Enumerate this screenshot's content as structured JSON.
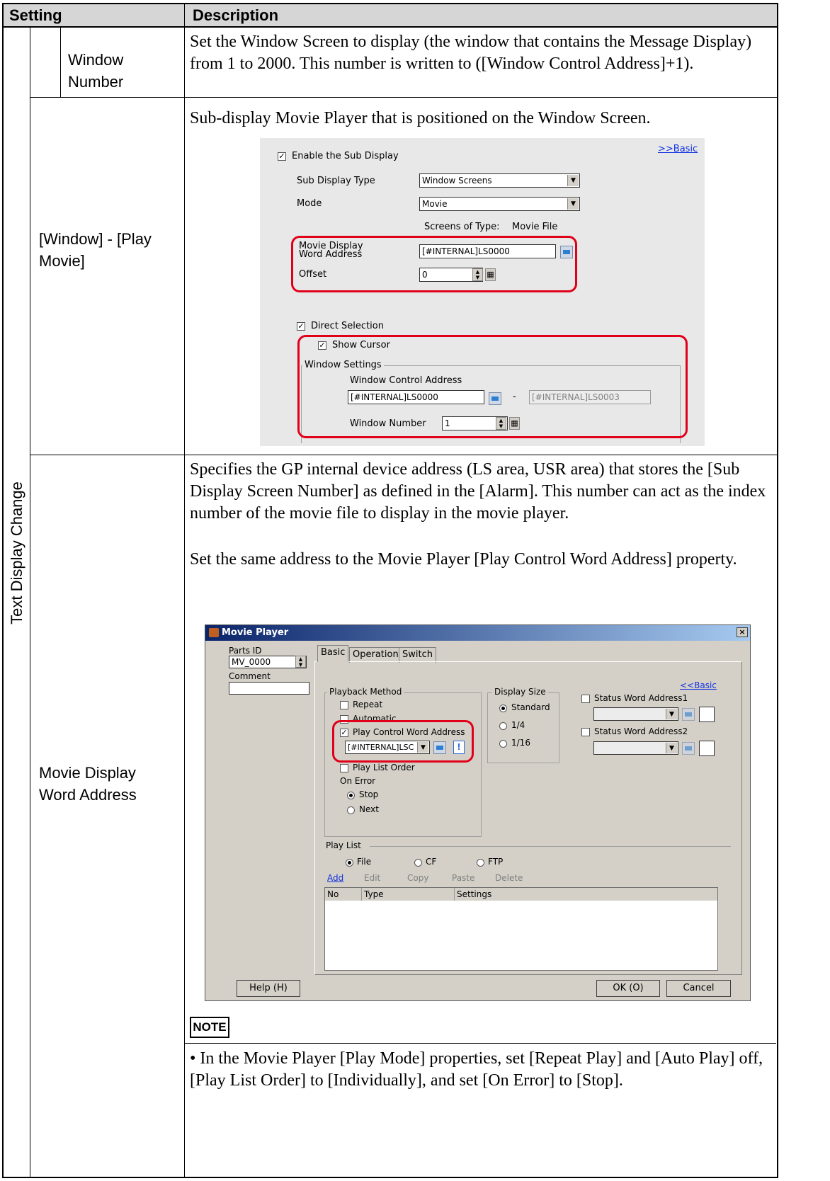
{
  "header": {
    "setting": "Setting",
    "description": "Description"
  },
  "category_vertical": "Text Display Change",
  "rows": [
    {
      "label": "Window Number",
      "desc": "Set the Window Screen to display (the window that contains the Message Display) from 1 to 2000. This number is written to ([Window Control Address]+1)."
    },
    {
      "label": "[Window] - [Play Movie]",
      "desc": "Sub-display Movie Player that is positioned on the Window Screen."
    },
    {
      "label": "Movie Display Word Address",
      "desc": "Specifies the GP internal device address (LS area, USR area) that stores the [Sub Display Screen Number] as defined in the [Alarm]. This number can act as the index number of the movie file to display in the movie player.",
      "desc2": "Set the same address to the Movie Player [Play Control Word Address] property."
    }
  ],
  "subdisplay": {
    "basic_link": ">>Basic",
    "enable_sub_display": "Enable the Sub Display",
    "sub_display_type_label": "Sub Display Type",
    "sub_display_type_value": "Window Screens",
    "mode_label": "Mode",
    "mode_value": "Movie",
    "screens_of_type_label": "Screens of Type:",
    "screens_of_type_value": "Movie File",
    "movie_display_word_label": "Movie Display Word Address",
    "movie_display_word_value": "[#INTERNAL]LS0000",
    "offset_label": "Offset",
    "offset_value": "0",
    "direct_selection": "Direct Selection",
    "show_cursor": "Show Cursor",
    "window_settings": "Window Settings",
    "window_control_address_label": "Window Control Address",
    "window_control_address_value": "[#INTERNAL]LS0000",
    "dash": "-",
    "window_control_address_end": "[#INTERNAL]LS0003",
    "window_number_label": "Window Number",
    "window_number_value": "1"
  },
  "movieplayer": {
    "title": "Movie Player",
    "close": "×",
    "parts_id_label": "Parts ID",
    "parts_id_value": "MV_0000",
    "comment_label": "Comment",
    "tabs": [
      "Basic",
      "Operation",
      "Switch"
    ],
    "basic_link": "<<Basic",
    "playback_method": "Playback Method",
    "repeat": "Repeat",
    "automatic": "Automatic",
    "play_control_word": "Play Control Word Address",
    "play_control_value": "[#INTERNAL]LSC",
    "play_list_order": "Play List Order",
    "on_error": "On Error",
    "stop": "Stop",
    "next": "Next",
    "display_size": "Display Size",
    "standard": "Standard",
    "quarter": "1/4",
    "sixteenth": "1/16",
    "status_word_1": "Status Word Address1",
    "status_word_2": "Status Word Address2",
    "play_list": "Play List",
    "file": "File",
    "cf": "CF",
    "ftp": "FTP",
    "add": "Add",
    "edit": "Edit",
    "copy": "Copy",
    "paste": "Paste",
    "delete": "Delete",
    "col_no": "No",
    "col_type": "Type",
    "col_settings": "Settings",
    "help": "Help (H)",
    "ok": "OK (O)",
    "cancel": "Cancel"
  },
  "note": {
    "label": "NOTE",
    "text": "• In the Movie Player [Play Mode] properties, set [Repeat Play] and [Auto Play] off, [Play List Order] to [Individually], and set [On Error] to [Stop]."
  }
}
